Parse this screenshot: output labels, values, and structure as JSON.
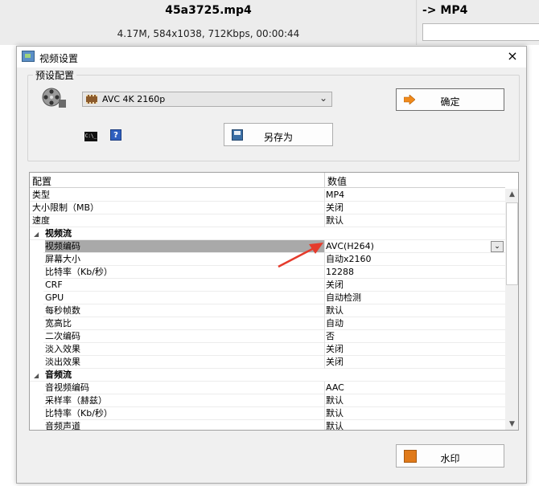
{
  "background": {
    "file_name": "45a3725.mp4",
    "file_info": "4.17M, 584x1038, 712Kbps, 00:00:44",
    "target_format": "-> MP4"
  },
  "dialog": {
    "title": "视频设置",
    "close_glyph": "×",
    "group_label": "预设配置",
    "preset_value": "AVC 4K 2160p",
    "ok_label": "确定",
    "saveas_label": "另存为",
    "help_glyph": "?",
    "cmd_glyph": "C:\\_",
    "watermark_label": "水印"
  },
  "grid": {
    "col_config": "配置",
    "col_value": "数值",
    "rows": [
      {
        "key": "类型",
        "value": "MP4",
        "kind": "top"
      },
      {
        "key": "大小限制（MB）",
        "value": "关闭",
        "kind": "top"
      },
      {
        "key": "速度",
        "value": "默认",
        "kind": "top"
      },
      {
        "key": "视频流",
        "value": "",
        "kind": "cat"
      },
      {
        "key": "视频编码",
        "value": "AVC(H264)",
        "kind": "sub",
        "selected": true
      },
      {
        "key": "屏幕大小",
        "value": "自动x2160",
        "kind": "sub"
      },
      {
        "key": "比特率（Kb/秒）",
        "value": "12288",
        "kind": "sub"
      },
      {
        "key": "CRF",
        "value": "关闭",
        "kind": "sub"
      },
      {
        "key": "GPU",
        "value": "自动检测",
        "kind": "sub"
      },
      {
        "key": "每秒帧数",
        "value": "默认",
        "kind": "sub"
      },
      {
        "key": "宽高比",
        "value": "自动",
        "kind": "sub"
      },
      {
        "key": "二次编码",
        "value": "否",
        "kind": "sub"
      },
      {
        "key": "淡入效果",
        "value": "关闭",
        "kind": "sub"
      },
      {
        "key": "淡出效果",
        "value": "关闭",
        "kind": "sub"
      },
      {
        "key": "音频流",
        "value": "",
        "kind": "cat"
      },
      {
        "key": "音视频编码",
        "value": "AAC",
        "kind": "sub"
      },
      {
        "key": "采样率（赫兹）",
        "value": "默认",
        "kind": "sub"
      },
      {
        "key": "比特率（Kb/秒）",
        "value": "默认",
        "kind": "sub"
      },
      {
        "key": "音频声道",
        "value": "默认",
        "kind": "sub"
      }
    ]
  },
  "icons": {
    "dialog_icon": "video-settings-icon",
    "preset_icon": "film-reel-icon",
    "ok_icon": "arrow-right-icon",
    "saveas_icon": "save-disk-icon",
    "watermark_icon": "watermark-icon",
    "annotation": "red-arrow-icon"
  },
  "colors": {
    "selection": "#a9a9a9",
    "annotation": "#e53b2c",
    "accent": "#e07a1a"
  }
}
